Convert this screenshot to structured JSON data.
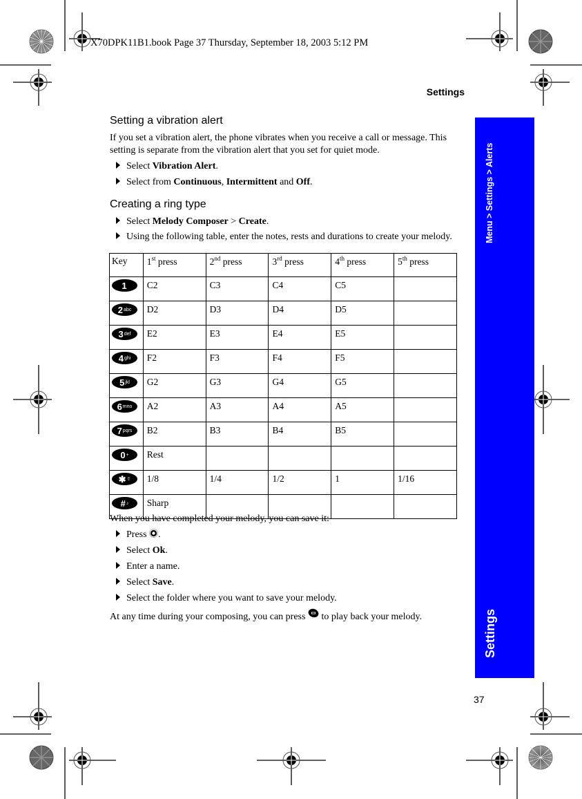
{
  "slug": "X70DPK11B1.book  Page 37  Thursday, September 18, 2003  5:12 PM",
  "running_head": "Settings",
  "side_tab": {
    "path": "Menu > Settings > Alerts",
    "section": "Settings",
    "color": "#0000ff"
  },
  "page_number": "37",
  "sections": {
    "vibration": {
      "title": "Setting a vibration alert",
      "intro": "If you set a vibration alert, the phone vibrates when you receive a call or message. This setting is separate from the vibration alert that you set for quiet mode.",
      "steps": [
        {
          "pre": "Select ",
          "b1": "Vibration Alert",
          "post": "."
        },
        {
          "pre": "Select from ",
          "b1": "Continuous",
          "mid1": ", ",
          "b2": "Intermittent",
          "mid2": " and ",
          "b3": "Off",
          "post": "."
        }
      ]
    },
    "ring": {
      "title": "Creating a ring type",
      "steps": [
        {
          "pre": "Select ",
          "b1": "Melody Composer",
          "mid1": " > ",
          "b2": "Create",
          "post": "."
        },
        {
          "text": "Using the following table, enter the notes, rests and durations to create your melody."
        }
      ]
    }
  },
  "table": {
    "headers": [
      {
        "text": "Key"
      },
      {
        "num": "1",
        "sup": "st",
        "text": " press"
      },
      {
        "num": "2",
        "sup": "nd",
        "text": " press"
      },
      {
        "num": "3",
        "sup": "rd",
        "text": " press"
      },
      {
        "num": "4",
        "sup": "th",
        "text": " press"
      },
      {
        "num": "5",
        "sup": "th",
        "text": " press"
      }
    ],
    "rows": [
      {
        "key": {
          "icon": "key-1-icon",
          "digit": "1",
          "letters": ""
        },
        "cells": [
          "C2",
          "C3",
          "C4",
          "C5",
          ""
        ]
      },
      {
        "key": {
          "icon": "key-2-icon",
          "digit": "2",
          "letters": "abc"
        },
        "cells": [
          "D2",
          "D3",
          "D4",
          "D5",
          ""
        ]
      },
      {
        "key": {
          "icon": "key-3-icon",
          "digit": "3",
          "letters": "def"
        },
        "cells": [
          "E2",
          "E3",
          "E4",
          "E5",
          ""
        ]
      },
      {
        "key": {
          "icon": "key-4-icon",
          "digit": "4",
          "letters": "ghi"
        },
        "cells": [
          "F2",
          "F3",
          "F4",
          "F5",
          ""
        ]
      },
      {
        "key": {
          "icon": "key-5-icon",
          "digit": "5",
          "letters": "jkl"
        },
        "cells": [
          "G2",
          "G3",
          "G4",
          "G5",
          ""
        ]
      },
      {
        "key": {
          "icon": "key-6-icon",
          "digit": "6",
          "letters": "mno"
        },
        "cells": [
          "A2",
          "A3",
          "A4",
          "A5",
          ""
        ]
      },
      {
        "key": {
          "icon": "key-7-icon",
          "digit": "7",
          "letters": "pqrs"
        },
        "cells": [
          "B2",
          "B3",
          "B4",
          "B5",
          ""
        ]
      },
      {
        "key": {
          "icon": "key-0-icon",
          "digit": "0",
          "letters": "+"
        },
        "cells": [
          "Rest",
          "",
          "",
          "",
          ""
        ]
      },
      {
        "key": {
          "icon": "key-star-icon",
          "digit": "✱",
          "letters": "⇧"
        },
        "cells": [
          "1/8",
          "1/4",
          "1/2",
          "1",
          "1/16"
        ]
      },
      {
        "key": {
          "icon": "key-hash-icon",
          "digit": "#",
          "letters": "♪"
        },
        "cells": [
          "Sharp",
          "",
          "",
          "",
          ""
        ]
      }
    ]
  },
  "save": {
    "intro": "When you have completed your melody, you can save it:",
    "steps": [
      {
        "pre": "Press ",
        "icon": "ok-key-icon",
        "post": "."
      },
      {
        "pre": "Select ",
        "b1": "Ok",
        "post": "."
      },
      {
        "text": "Enter a name."
      },
      {
        "pre": "Select ",
        "b1": "Save",
        "post": "."
      },
      {
        "text": "Select the folder where you want to save your melody."
      }
    ],
    "outro_pre": "At any time during your composing, you can press ",
    "outro_icon": "play-key-icon",
    "outro_post": " to play back your melody."
  }
}
